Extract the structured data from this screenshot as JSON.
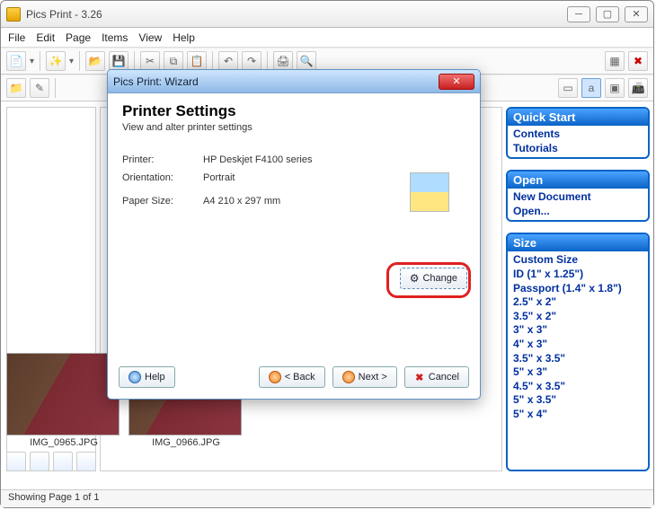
{
  "window": {
    "title": "Pics Print - 3.26"
  },
  "menu": {
    "file": "File",
    "edit": "Edit",
    "page": "Page",
    "items": "Items",
    "view": "View",
    "help": "Help"
  },
  "wizard": {
    "title": "Pics Print: Wizard",
    "heading": "Printer Settings",
    "subtitle": "View and alter printer settings",
    "labels": {
      "printer": "Printer:",
      "orientation": "Orientation:",
      "paper": "Paper Size:"
    },
    "values": {
      "printer": "HP Deskjet F4100 series",
      "orientation": "Portrait",
      "paper": "A4 210 x 297 mm"
    },
    "buttons": {
      "change": "Change",
      "help": "Help",
      "back": "< Back",
      "next": "Next >",
      "cancel": "Cancel"
    }
  },
  "thumbs": {
    "img1": "IMG_0965.JPG",
    "img2": "IMG_0966.JPG"
  },
  "panels": {
    "quickstart": {
      "title": "Quick Start",
      "items": [
        "Contents",
        "Tutorials"
      ]
    },
    "open": {
      "title": "Open",
      "items": [
        "New Document",
        "Open..."
      ]
    },
    "size": {
      "title": "Size",
      "items": [
        "Custom Size",
        "ID (1\" x 1.25\")",
        "Passport (1.4\" x 1.8\")",
        "2.5\" x 2\"",
        "3.5\" x 2\"",
        "3\" x 3\"",
        "4\" x 3\"",
        "3.5\" x 3.5\"",
        "5\" x 3\"",
        "4.5\" x 3.5\"",
        "5\" x 3.5\"",
        "5\" x 4\""
      ]
    }
  },
  "status": {
    "text": "Showing Page 1 of 1"
  }
}
